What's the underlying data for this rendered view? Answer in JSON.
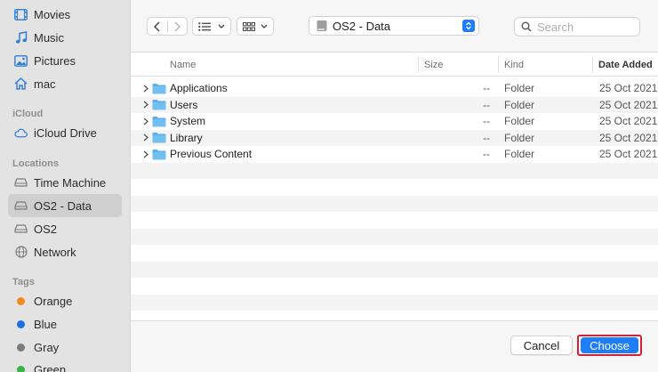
{
  "sidebar": {
    "favorites": [
      {
        "label": "Movies",
        "icon": "film-icon"
      },
      {
        "label": "Music",
        "icon": "music-note-icon"
      },
      {
        "label": "Pictures",
        "icon": "photo-icon"
      },
      {
        "label": "mac",
        "icon": "home-icon"
      }
    ],
    "icloud_header": "iCloud",
    "icloud": [
      {
        "label": "iCloud Drive",
        "icon": "cloud-icon"
      }
    ],
    "locations_header": "Locations",
    "locations": [
      {
        "label": "Time Machine",
        "icon": "drive-icon"
      },
      {
        "label": "OS2 - Data",
        "icon": "drive-icon",
        "selected": true
      },
      {
        "label": "OS2",
        "icon": "drive-icon"
      },
      {
        "label": "Network",
        "icon": "globe-icon"
      }
    ],
    "tags_header": "Tags",
    "tags": [
      {
        "label": "Orange",
        "color": "#f0891e"
      },
      {
        "label": "Blue",
        "color": "#1f6fe0"
      },
      {
        "label": "Gray",
        "color": "#7a7a7a"
      },
      {
        "label": "Green",
        "color": "#3cb34a"
      }
    ]
  },
  "toolbar": {
    "location": "OS2 - Data",
    "search_placeholder": "Search"
  },
  "columns": {
    "name": "Name",
    "size": "Size",
    "kind": "Kind",
    "date_added": "Date Added"
  },
  "files": [
    {
      "name": "Applications",
      "size": "--",
      "kind": "Folder",
      "date_added": "25 Oct 2021"
    },
    {
      "name": "Users",
      "size": "--",
      "kind": "Folder",
      "date_added": "25 Oct 2021"
    },
    {
      "name": "System",
      "size": "--",
      "kind": "Folder",
      "date_added": "25 Oct 2021"
    },
    {
      "name": "Library",
      "size": "--",
      "kind": "Folder",
      "date_added": "25 Oct 2021"
    },
    {
      "name": "Previous Content",
      "size": "--",
      "kind": "Folder",
      "date_added": "25 Oct 2021"
    }
  ],
  "footer": {
    "cancel_label": "Cancel",
    "choose_label": "Choose"
  },
  "colors": {
    "accent": "#1f7ef6",
    "highlight_border": "#d0223a",
    "folder": "#5ab0ea"
  }
}
